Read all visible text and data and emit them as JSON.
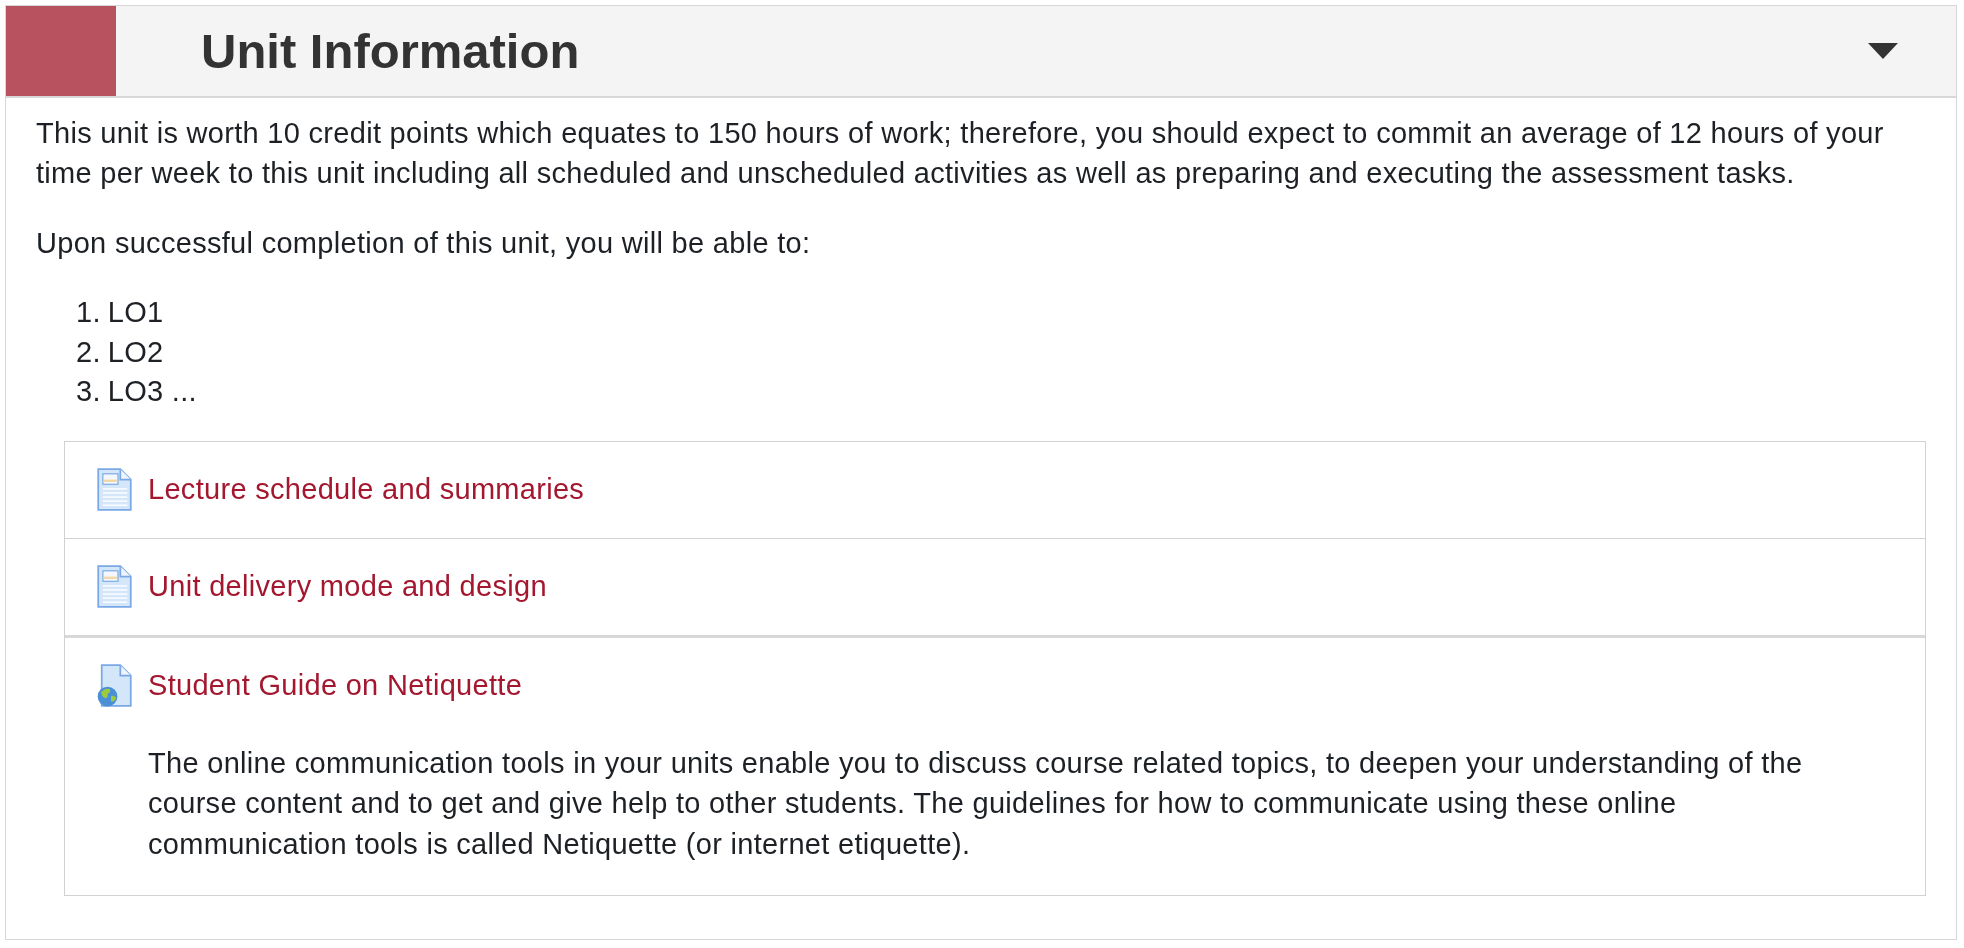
{
  "section": {
    "title": "Unit Information",
    "expanded": true
  },
  "summary": {
    "paragraphs": [
      "This unit is worth 10 credit points which equates to 150 hours of work; therefore, you should expect to commit an average of 12 hours of your time per week to this unit including all scheduled and unscheduled activities as well as preparing and executing the assessment tasks.",
      "Upon successful completion of this unit, you will be able to:"
    ],
    "outcomes": [
      {
        "number": "1.",
        "text": "LO1"
      },
      {
        "number": "2.",
        "text": "LO2"
      },
      {
        "number": "3.",
        "text": "LO3 ..."
      }
    ]
  },
  "activities": [
    {
      "kind": "page",
      "title": "Lecture schedule and summaries"
    },
    {
      "kind": "page",
      "title": "Unit delivery mode and design"
    },
    {
      "kind": "url",
      "title": "Student Guide on Netiquette",
      "description": "The online communication tools in your units enable you to discuss course related topics, to deepen your understanding of the course content and to get and give help to other students. The guidelines for how to communicate using these online communication tools is called Netiquette (or internet etiquette)."
    }
  ]
}
